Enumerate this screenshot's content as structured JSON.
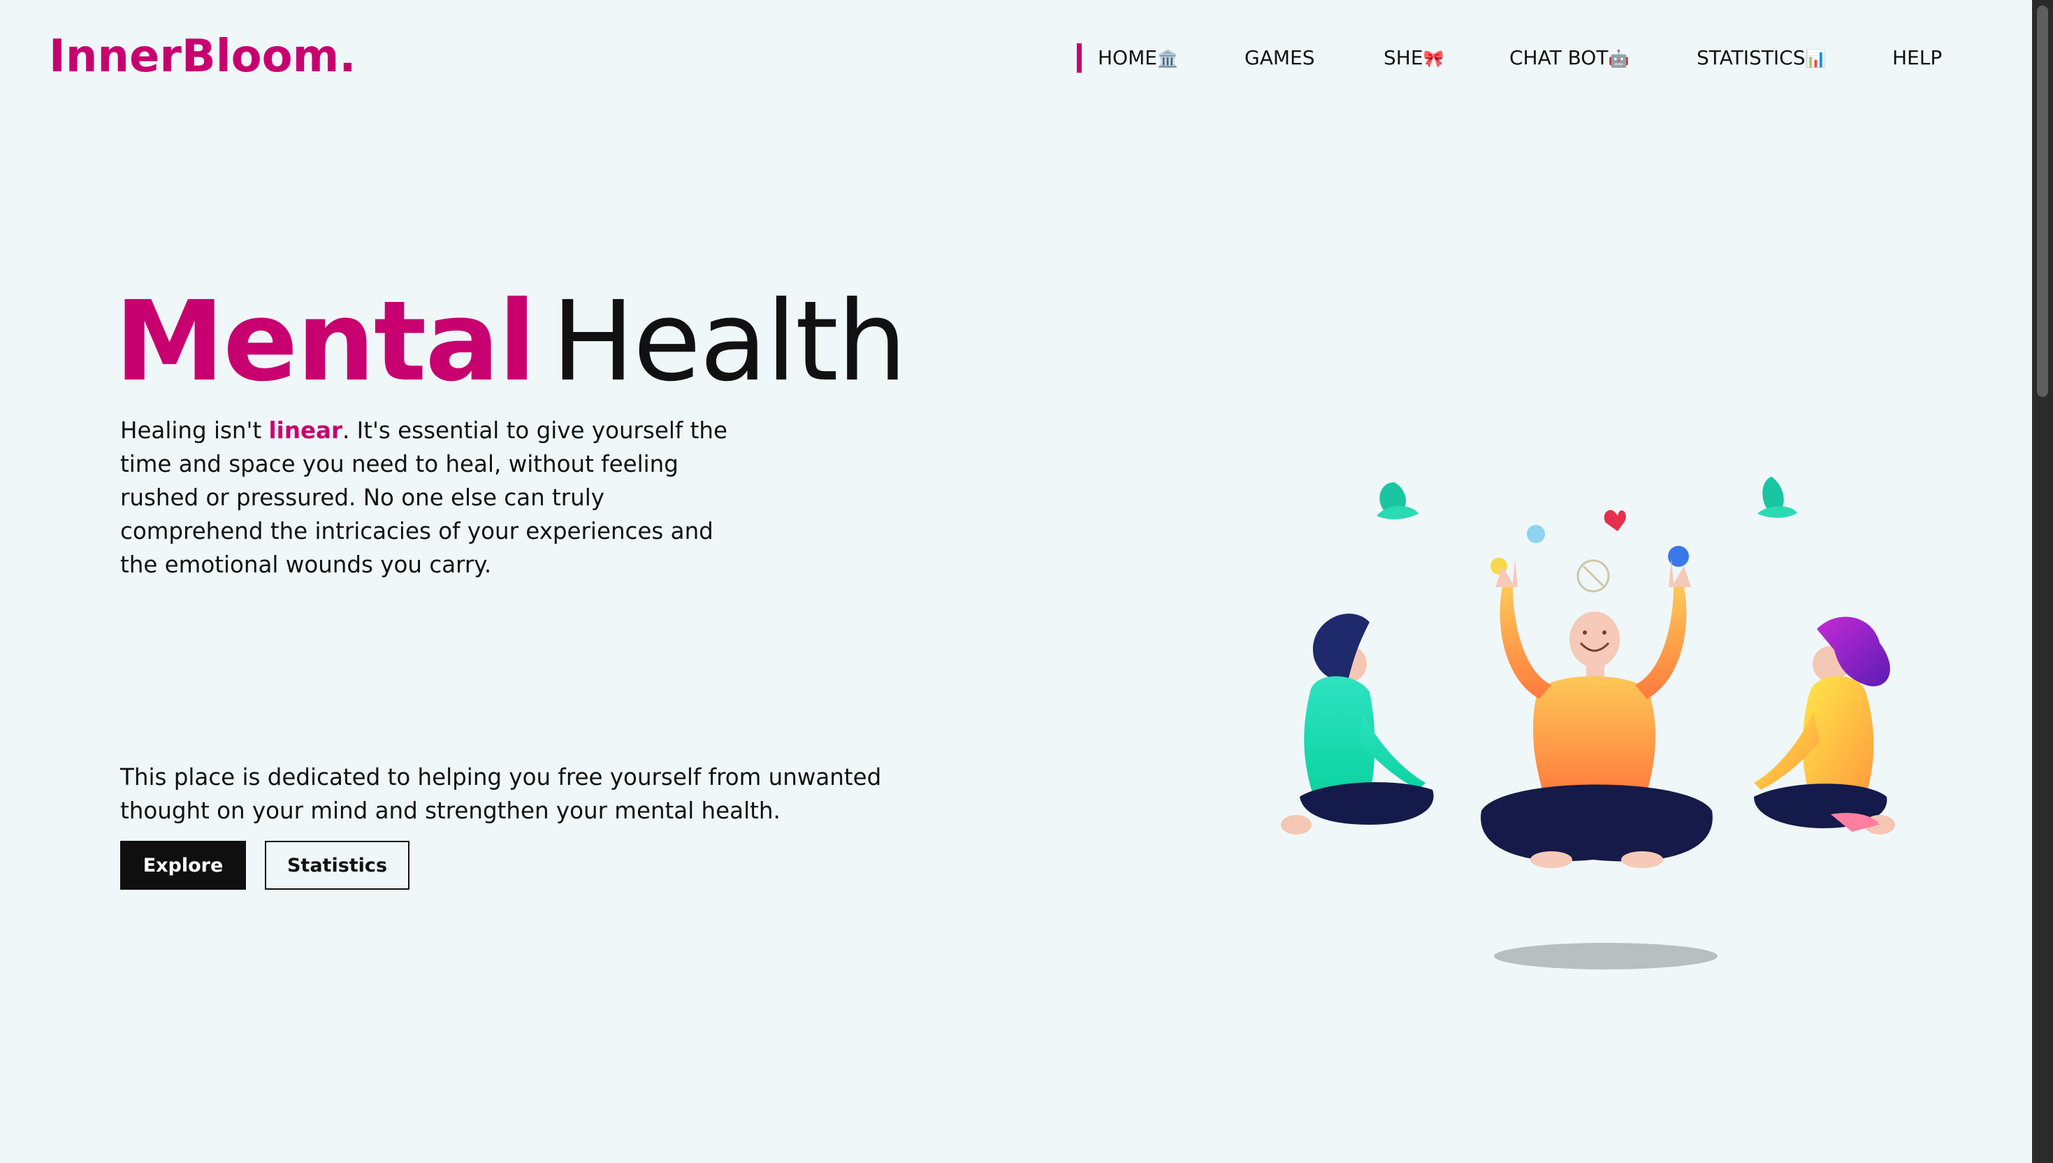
{
  "brand": {
    "logo": "InnerBloom."
  },
  "nav": {
    "items": [
      {
        "label": "HOME",
        "emoji": "🏛️",
        "active": true
      },
      {
        "label": "GAMES",
        "emoji": ""
      },
      {
        "label": "SHE",
        "emoji": "🎀"
      },
      {
        "label": "CHAT BOT",
        "emoji": "🤖"
      },
      {
        "label": "STATISTICS",
        "emoji": "📊"
      },
      {
        "label": "HELP",
        "emoji": ""
      }
    ]
  },
  "hero": {
    "title_bold": "Mental",
    "title_light": "Health",
    "para1_before": "Healing isn't ",
    "para1_highlight": "linear",
    "para1_after": ". It's essential to give yourself the time and space you need to heal, without feeling rushed or pressured. No one else can truly comprehend the intricacies of your experiences and the emotional wounds you carry.",
    "para2": "This place is dedicated to helping you free yourself from unwanted thought on your mind and strengthen your mental health.",
    "explore_label": "Explore",
    "statistics_label": "Statistics"
  },
  "colors": {
    "accent": "#c8006f",
    "background": "#eff7f9",
    "text": "#111111"
  },
  "illustration": {
    "icon": "meditation-illustration"
  }
}
